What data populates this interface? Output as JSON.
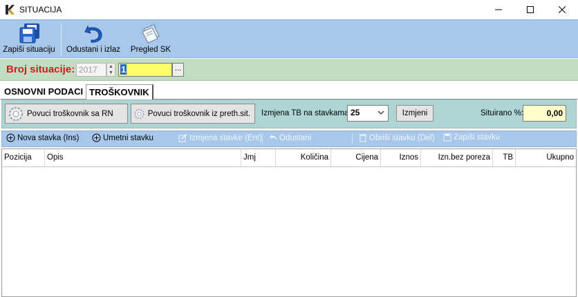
{
  "window": {
    "title": "SITUACIJA",
    "logo_icon": "k-logo-icon",
    "controls": [
      "minimize-icon",
      "maximize-icon",
      "close-icon"
    ]
  },
  "toolbar": {
    "save_label": "Zapiši situaciju",
    "cancel_label": "Odustani i izlaz",
    "review_label": "Pregled SK"
  },
  "header": {
    "label": "Broj situacije:",
    "year": "2017",
    "number": "1",
    "browse_label": "..."
  },
  "tabs": [
    {
      "label": "OSNOVNI PODACI",
      "active": false
    },
    {
      "label": "TROŠKOVNIK",
      "active": true
    }
  ],
  "actions": {
    "pull_rn_label": "Povuci troškovnik sa RN",
    "pull_prev_label": "Povuci troškovnik iz preth.sit.",
    "tb_change_label": "Izmjena TB na stavkama:",
    "tb_value": "25",
    "change_button_label": "Izmjeni",
    "situirano_label": "Situirano %:",
    "situirano_value": "0,00"
  },
  "items_toolbar": {
    "new_item": "Nova stavka (Ins)",
    "insert_item": "Umetni stavku",
    "edit_item": "Izmjena stavke (Ent)",
    "cancel": "Odustani",
    "delete_item": "Obriši stavku (Del)",
    "save_item": "Zapiši stavku"
  },
  "grid": {
    "columns": [
      "Pozicija",
      "Opis",
      "Jmj",
      "Količina",
      "Cijena",
      "Iznos",
      "Izn.bez poreza",
      "TB",
      "Ukupno"
    ],
    "rows": []
  },
  "colors": {
    "toolbar": "#a7c8ea",
    "header_row": "#c2dec2",
    "action_bar": "#aed4d4",
    "label_red": "#d11a1a",
    "number_field": "#ffff66",
    "situirano_field": "#ffffcc"
  }
}
